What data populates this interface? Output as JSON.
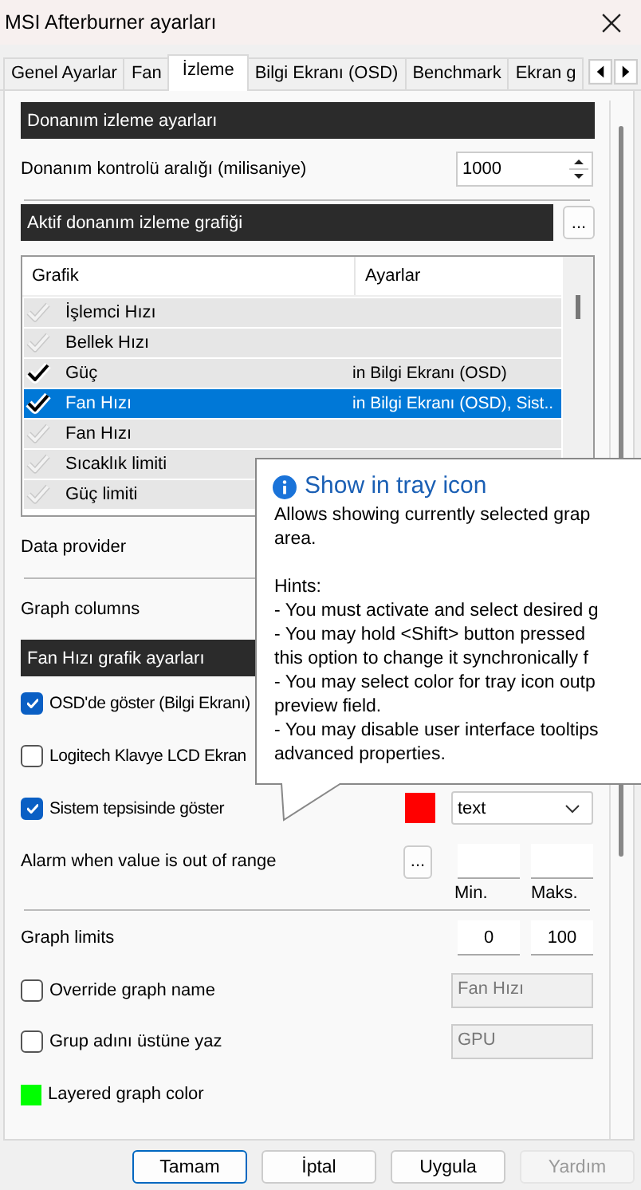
{
  "window": {
    "title": "MSI Afterburner ayarları"
  },
  "tabs": [
    {
      "label": "Genel Ayarlar",
      "selected": false
    },
    {
      "label": "Fan",
      "selected": false
    },
    {
      "label": "İzleme",
      "selected": true
    },
    {
      "label": "Bilgi Ekranı (OSD)",
      "selected": false
    },
    {
      "label": "Benchmark",
      "selected": false
    },
    {
      "label": "Ekran g",
      "selected": false
    }
  ],
  "monitoring": {
    "header": "Donanım izleme ayarları",
    "interval_label": "Donanım kontrolü aralığı (milisaniye)",
    "interval_value": "1000"
  },
  "graphs": {
    "header": "Aktif donanım izleme grafiği",
    "more_button": "...",
    "columns": [
      "Grafik",
      "Ayarlar"
    ],
    "rows": [
      {
        "name": "İşlemci Hızı",
        "settings": "",
        "checked": false,
        "selected": false
      },
      {
        "name": "Bellek Hızı",
        "settings": "",
        "checked": false,
        "selected": false
      },
      {
        "name": "Güç",
        "settings": "in Bilgi Ekranı (OSD)",
        "checked": true,
        "selected": false
      },
      {
        "name": "Fan Hızı",
        "settings": "in Bilgi Ekranı (OSD), Sist..",
        "checked": true,
        "selected": true
      },
      {
        "name": "Fan Hızı",
        "settings": "",
        "checked": false,
        "selected": false
      },
      {
        "name": "Sıcaklık limiti",
        "settings": "",
        "checked": false,
        "selected": false
      },
      {
        "name": "Güç limiti",
        "settings": "",
        "checked": false,
        "selected": false
      }
    ]
  },
  "data_provider_label": "Data provider",
  "graph_columns_label": "Graph columns",
  "graph_settings": {
    "header": "Fan Hızı grafik ayarları",
    "options": [
      {
        "label": "OSD'de göster (Bilgi Ekranı)",
        "checked": true
      },
      {
        "label": "Logitech Klavye LCD Ekran",
        "checked": false
      },
      {
        "label": "Sistem tepsisinde göster",
        "checked": true,
        "color": "#ff0000",
        "dropdown": "text"
      }
    ],
    "alarm": {
      "label": "Alarm when value is out of range",
      "button": "...",
      "min_label": "Min.",
      "max_label": "Maks."
    },
    "limits": {
      "label": "Graph limits",
      "min": "0",
      "max": "100"
    },
    "override_name": {
      "label": "Override graph name",
      "checked": false,
      "value": "Fan Hızı"
    },
    "override_group": {
      "label": "Grup adını üstüne yaz",
      "checked": false,
      "value": "GPU"
    },
    "layered": {
      "label": "Layered graph color",
      "color": "#00ff00"
    }
  },
  "tooltip": {
    "title": "Show in tray icon",
    "paragraphs": [
      [
        "Allows showing currently selected grap",
        "area."
      ],
      [
        "Hints:",
        "- You must activate and select desired g",
        "- You may hold <Shift> button pressed",
        "this option to change it synchronically f",
        "- You may select color for tray icon outp",
        "preview field.",
        "- You may disable user interface tooltips",
        "advanced properties."
      ]
    ]
  },
  "buttons": [
    {
      "label": "Tamam",
      "kind": "default",
      "disabled": false
    },
    {
      "label": "İptal",
      "kind": "normal",
      "disabled": false
    },
    {
      "label": "Uygula",
      "kind": "normal",
      "disabled": false
    },
    {
      "label": "Yardım",
      "kind": "normal",
      "disabled": true
    }
  ]
}
